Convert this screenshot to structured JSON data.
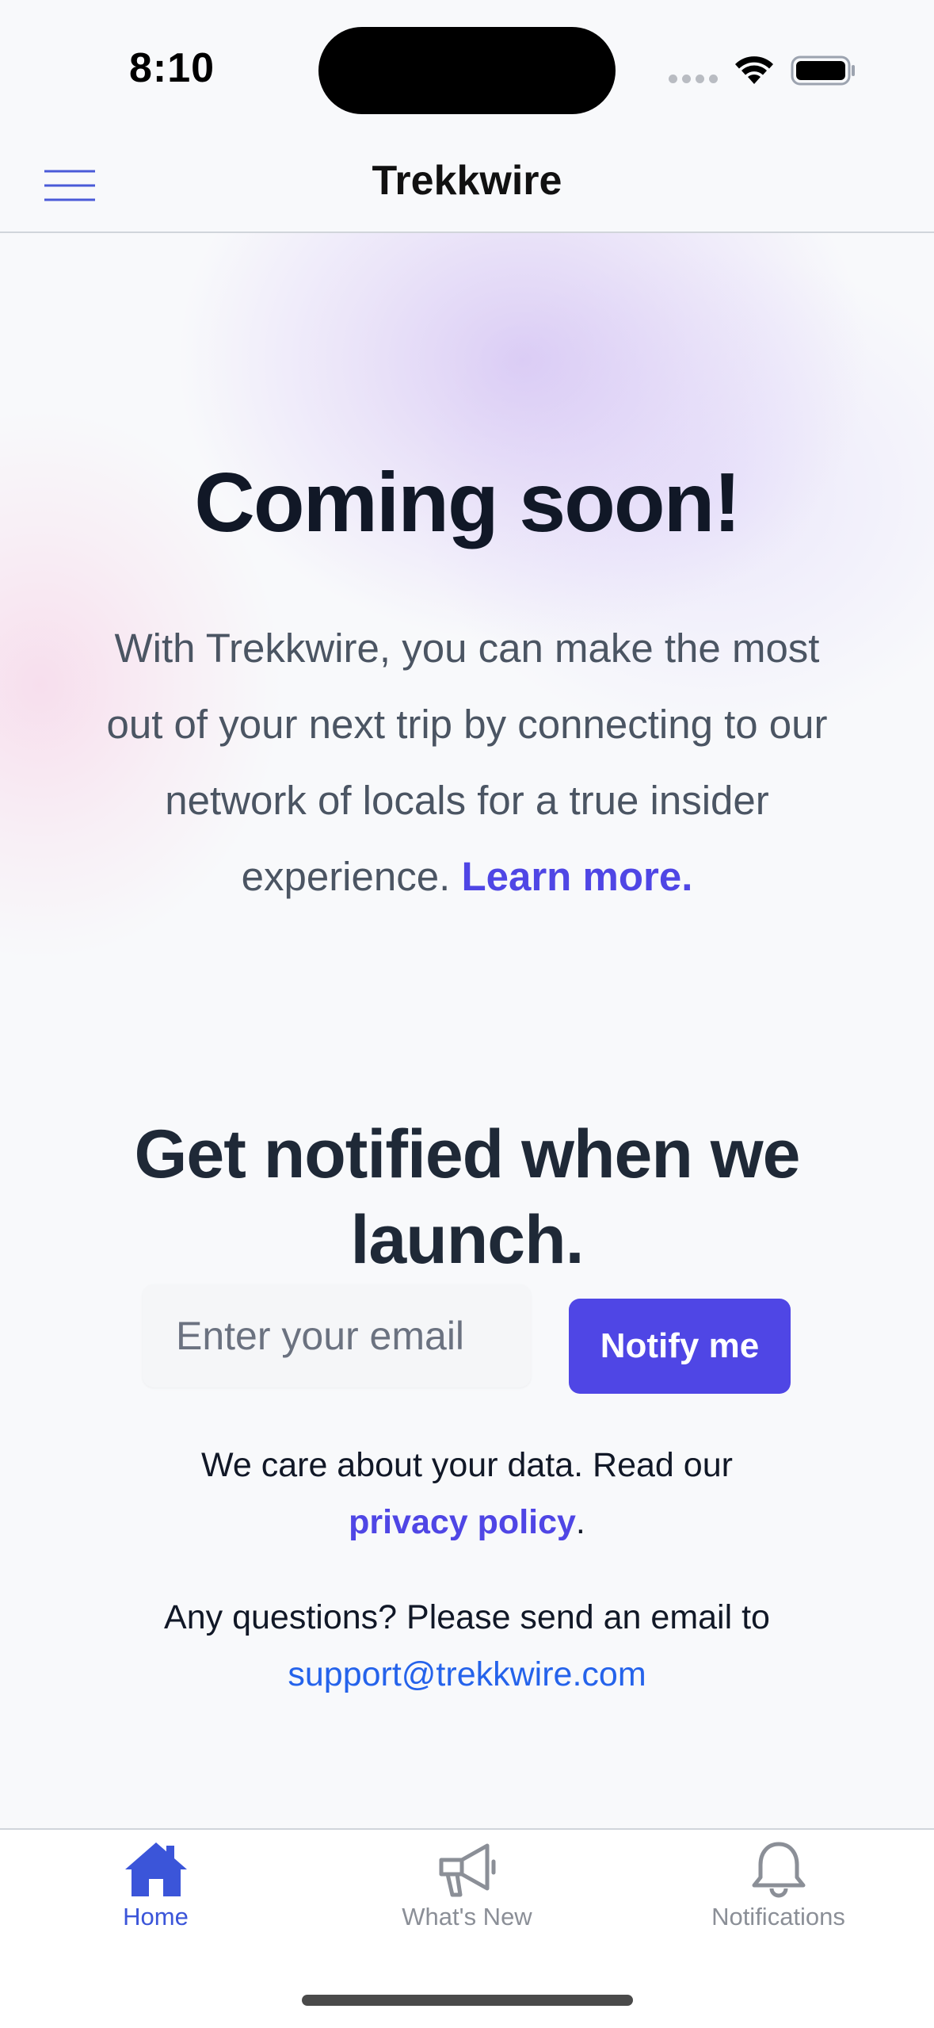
{
  "status_bar": {
    "time": "8:10"
  },
  "header": {
    "title": "Trekkwire",
    "menu_icon": "hamburger-menu-icon"
  },
  "hero": {
    "title": "Coming soon!",
    "body": "With Trekkwire, you can make the most out of your next trip by connecting to our network of locals for a true insider experience.",
    "learn_more": "Learn more."
  },
  "signup": {
    "title": "Get notified when we launch.",
    "email_placeholder": "Enter your email",
    "email_value": "",
    "button_label": "Notify me"
  },
  "privacy": {
    "text": "We care about your data. Read our",
    "link": "privacy policy",
    "suffix": "."
  },
  "contact": {
    "text": "Any questions? Please send an email to",
    "email": "support@trekkwire.com"
  },
  "tabs": [
    {
      "label": "Home",
      "icon": "home-icon",
      "active": true
    },
    {
      "label": "What's New",
      "icon": "megaphone-icon",
      "active": false
    },
    {
      "label": "Notifications",
      "icon": "bell-icon",
      "active": false
    }
  ],
  "colors": {
    "accent": "#4f46e5",
    "tab_active": "#3b55d9",
    "tab_inactive": "#8b8f97",
    "link_blue": "#2563eb",
    "heading": "#111827",
    "body_text": "#4b5563"
  }
}
